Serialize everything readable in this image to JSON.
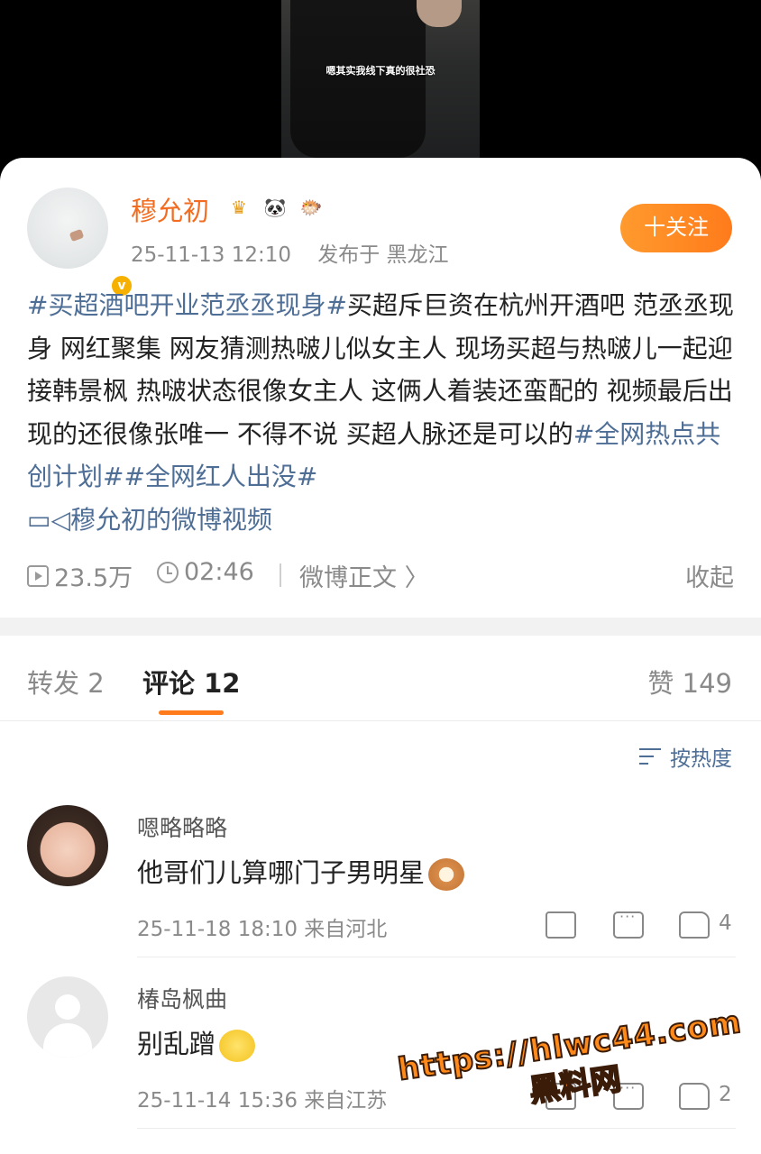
{
  "video": {
    "caption": "嗯其实我线下真的很社恐"
  },
  "post": {
    "username": "穆允初",
    "timestamp": "25-11-13 12:10",
    "location": "发布于 黑龙江",
    "follow_label": "十关注",
    "verified_mark": "v",
    "badges": [
      "crown-badge",
      "panda-badge",
      "pufferfish-badge"
    ],
    "tag_topic": "#买超酒吧开业范丞丞现身#",
    "body": "买超斥巨资在杭州开酒吧 范丞丞现身 网红聚集 网友猜测热啵儿似女主人  现场买超与热啵儿一起迎接韩景枫 热啵状态很像女主人 这俩人着装还蛮配的 视频最后出现的还很像张唯一 不得不说 买超人脉还是可以的",
    "tag_1": "#全网热点共创计划#",
    "tag_2": "#全网红人出没#",
    "video_link": "穆允初的微博视频",
    "views": "23.5万",
    "duration": "02:46",
    "weibo_body_link": "微博正文 〉",
    "collapse_label": "收起"
  },
  "tabs": {
    "repost": "转发 2",
    "comments": "评论 12",
    "likes": "赞 149"
  },
  "sort_label": "按热度",
  "comments": [
    {
      "name": "嗯略略略",
      "text": "他哥们儿算哪门子男明星",
      "time_location": "25-11-18 18:10 来自河北",
      "likes": "4"
    },
    {
      "name": "椿岛枫曲",
      "text": "别乱蹭",
      "time_location": "25-11-14 15:36 来自江苏",
      "likes": "2"
    }
  ],
  "watermark": {
    "url": "https://hlwc44.com",
    "name": "黑料网"
  },
  "colors": {
    "accent_orange": "#ff7b1b",
    "username_orange": "#f26d21",
    "link_blue": "#4e6e96"
  }
}
